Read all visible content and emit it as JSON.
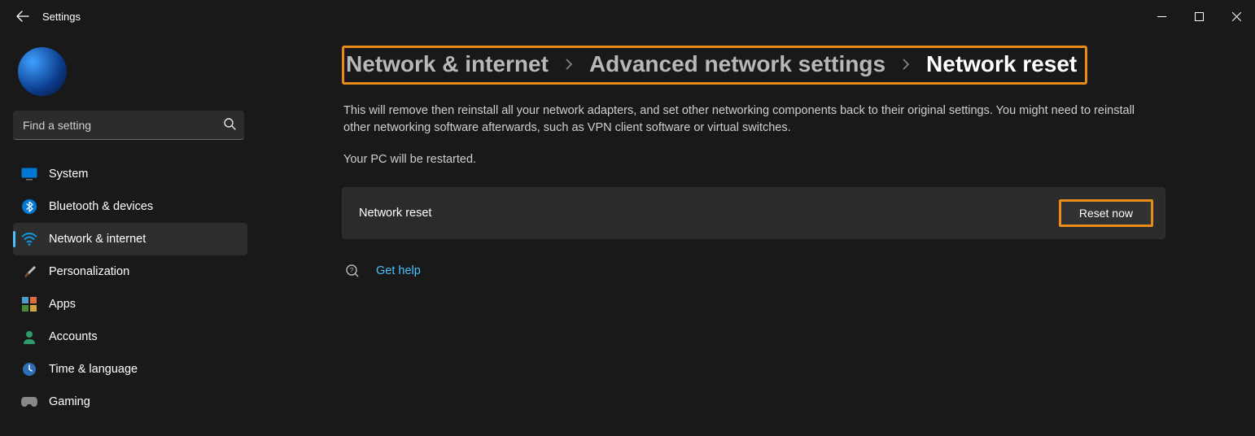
{
  "window": {
    "title": "Settings"
  },
  "search": {
    "placeholder": "Find a setting"
  },
  "sidebar": {
    "items": [
      {
        "label": "System"
      },
      {
        "label": "Bluetooth & devices"
      },
      {
        "label": "Network & internet"
      },
      {
        "label": "Personalization"
      },
      {
        "label": "Apps"
      },
      {
        "label": "Accounts"
      },
      {
        "label": "Time & language"
      },
      {
        "label": "Gaming"
      }
    ],
    "active_index": 2
  },
  "breadcrumb": {
    "parts": [
      "Network & internet",
      "Advanced network settings",
      "Network reset"
    ]
  },
  "content": {
    "description": "This will remove then reinstall all your network adapters, and set other networking components back to their original settings. You might need to reinstall other networking software afterwards, such as VPN client software or virtual switches.",
    "restart_note": "Your PC will be restarted.",
    "card_label": "Network reset",
    "reset_button": "Reset now",
    "help_link": "Get help"
  },
  "colors": {
    "highlight_border": "#e88b18",
    "accent_link": "#4cc2ff"
  }
}
